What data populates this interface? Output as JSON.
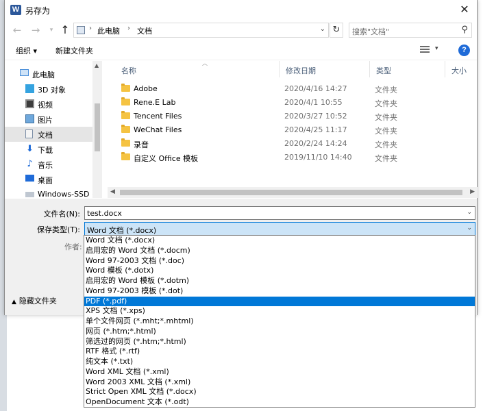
{
  "window": {
    "title": "另存为",
    "app_icon": "W"
  },
  "address": {
    "root": "此电脑",
    "current": "文档"
  },
  "search": {
    "placeholder": "搜索\"文档\""
  },
  "toolbar": {
    "organize": "组织 ▾",
    "new_folder": "新建文件夹",
    "help": "?"
  },
  "nav": [
    {
      "label": "此电脑",
      "icon": "computer-icon"
    },
    {
      "label": "3D 对象",
      "icon": "cube-icon"
    },
    {
      "label": "视频",
      "icon": "video-icon"
    },
    {
      "label": "图片",
      "icon": "picture-icon"
    },
    {
      "label": "文档",
      "icon": "document-icon",
      "selected": true
    },
    {
      "label": "下载",
      "icon": "download-icon"
    },
    {
      "label": "音乐",
      "icon": "music-icon"
    },
    {
      "label": "桌面",
      "icon": "desktop-icon"
    },
    {
      "label": "Windows-SSD (",
      "icon": "drive-icon"
    }
  ],
  "columns": {
    "name": "名称",
    "date": "修改日期",
    "type": "类型",
    "size": "大小"
  },
  "files": [
    {
      "name": "Adobe",
      "date": "2020/4/16 14:27",
      "type": "文件夹"
    },
    {
      "name": "Rene.E Lab",
      "date": "2020/4/1 10:55",
      "type": "文件夹"
    },
    {
      "name": "Tencent Files",
      "date": "2020/3/27 10:52",
      "type": "文件夹"
    },
    {
      "name": "WeChat Files",
      "date": "2020/4/25 11:17",
      "type": "文件夹"
    },
    {
      "name": "录音",
      "date": "2020/2/24 14:24",
      "type": "文件夹"
    },
    {
      "name": "自定义 Office 模板",
      "date": "2019/11/10 14:40",
      "type": "文件夹"
    }
  ],
  "form": {
    "filename_label": "文件名(N):",
    "filename_value": "test.docx",
    "filetype_label": "保存类型(T):",
    "filetype_value": "Word 文档 (*.docx)",
    "author_label": "作者:",
    "hide_folders": "隐藏文件夹"
  },
  "filetype_options": [
    {
      "label": "Word 文档 (*.docx)"
    },
    {
      "label": "启用宏的 Word 文档 (*.docm)"
    },
    {
      "label": "Word 97-2003 文档 (*.doc)"
    },
    {
      "label": "Word 模板 (*.dotx)"
    },
    {
      "label": "启用宏的 Word 模板 (*.dotm)"
    },
    {
      "label": "Word 97-2003 模板 (*.dot)"
    },
    {
      "label": "PDF (*.pdf)",
      "selected": true
    },
    {
      "label": "XPS 文档 (*.xps)"
    },
    {
      "label": "单个文件网页 (*.mht;*.mhtml)"
    },
    {
      "label": "网页 (*.htm;*.html)"
    },
    {
      "label": "筛选过的网页 (*.htm;*.html)"
    },
    {
      "label": "RTF 格式 (*.rtf)"
    },
    {
      "label": "纯文本 (*.txt)"
    },
    {
      "label": "Word XML 文档 (*.xml)"
    },
    {
      "label": "Word 2003 XML 文档 (*.xml)"
    },
    {
      "label": "Strict Open XML 文档 (*.docx)"
    },
    {
      "label": "OpenDocument 文本 (*.odt)"
    }
  ],
  "colors": {
    "accent": "#0078d7",
    "selection_bg": "#cce4f7",
    "folder": "#f5c342"
  }
}
